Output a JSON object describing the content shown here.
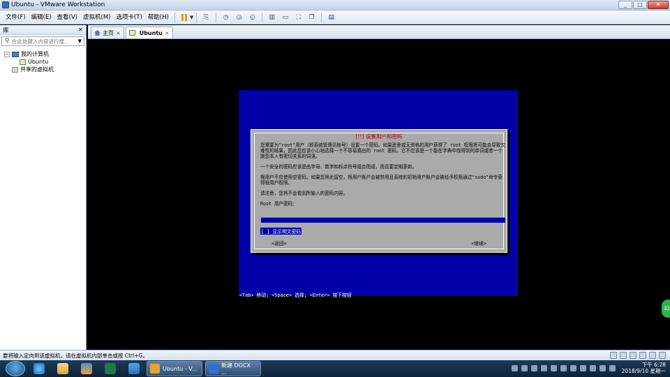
{
  "window": {
    "title": "Ubuntu - VMware Workstation"
  },
  "menu": {
    "items": [
      "文件(F)",
      "编辑(E)",
      "查看(V)",
      "虚拟机(M)",
      "选项卡(T)",
      "帮助(H)"
    ]
  },
  "library": {
    "title": "库",
    "close": "×",
    "search_placeholder": "在此处键入内容进行搜...",
    "my_computer": "我的计算机",
    "vm_ubuntu": "Ubuntu",
    "shared": "共享的虚拟机"
  },
  "tabs": [
    {
      "label": "主页",
      "close": "×"
    },
    {
      "label": "Ubuntu",
      "close": "×"
    }
  ],
  "installer": {
    "title": "[!!] 设置用户和密码",
    "para1": "您需要为\"root\"用户（即系统管理员账号）设置一个密码。如果恶意或无资格的用户获得了 root 权限将可能会导致灾难性的结果，因此您应该小心地选择一个不容易猜出的 root 密码。它不应该是一个能在字典中找得到的单词或者一个跟您本人有密切关系的词语。",
    "para2": "一个安全的密码应该是由字母、数字和标点符号组合而成，而且要定期更新。",
    "para3": "根用户不应使用空密码。如果您将此留空，根用户账户会被禁用且系统的初始用户账户会被给予权限通过\"sudo\"命令获得根用户权限。",
    "para4": "请注意，您将不会看到所输入的密码内容。",
    "field_label": "Root 用户密码：",
    "show_password": "[ ] 显示明文密码",
    "back": "<返回>",
    "continue": "<继续>",
    "hint": "<Tab> 移动; <Space> 选择; <Enter> 按下按钮"
  },
  "green_bubble": "32",
  "statusbar": {
    "text": "要将输入定向到该虚拟机，请在虚拟机内部单击或按 Ctrl+G。"
  },
  "taskbar": {
    "task1": "Ubuntu - V...",
    "task2": "新建 DOCX ..."
  },
  "clock": {
    "time": "下午 6:28",
    "date": "2018/9/10 星期一"
  }
}
